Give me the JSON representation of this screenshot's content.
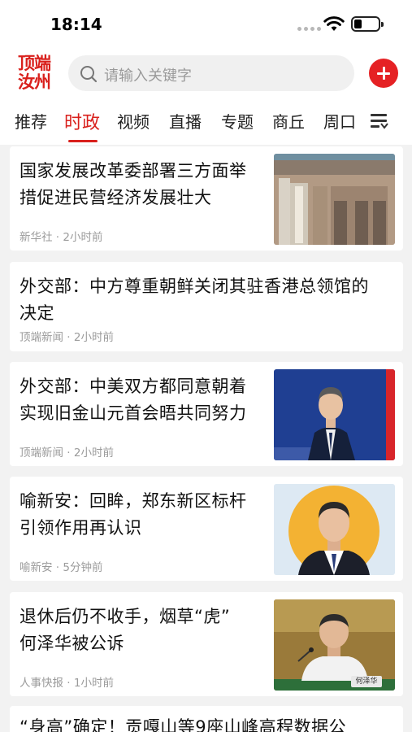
{
  "status_bar": {
    "time": "18:14",
    "battery_level": 0.2
  },
  "header": {
    "logo_line1": "顶端",
    "logo_line2": "汝州",
    "search_placeholder": "请输入关键字",
    "add_icon": "plus-circle-icon"
  },
  "tabs": {
    "items": [
      "推荐",
      "时政",
      "视频",
      "直播",
      "专题",
      "商丘",
      "周口"
    ],
    "active": "时政",
    "menu_icon": "list-menu-icon"
  },
  "news": [
    {
      "title_line1": "国家发展改革委部署三方面举",
      "title_line2": "措促进民营经济发展壮大",
      "source": "新华社",
      "time": "2小时前",
      "image": "ndrc-building-photo"
    },
    {
      "title_line1": "外交部：中方尊重朝鲜关闭其驻香港总领馆的",
      "title_line2": "决定",
      "source": "顶端新闻",
      "time": "2小时前"
    },
    {
      "title_line1": "外交部：中美双方都同意朝着",
      "title_line2": "实现旧金山元首会晤共同努力",
      "source": "顶端新闻",
      "time": "2小时前",
      "image": "spokesperson-photo"
    },
    {
      "title_line1": "喻新安：回眸，郑东新区标杆",
      "title_line2": "引领作用再认识",
      "source": "喻新安",
      "time": "5分钟前",
      "image": "author-portrait"
    },
    {
      "title_line1": "退休后仍不收手，烟草“虎”",
      "title_line2": "何泽华被公诉",
      "source": "人事快报",
      "time": "1小时前",
      "image": "official-photo",
      "image_caption": "何泽华"
    },
    {
      "title_line1": "“身高”确定！贡嘎山等9座山峰高程数据公",
      "title_line2": ""
    }
  ]
}
